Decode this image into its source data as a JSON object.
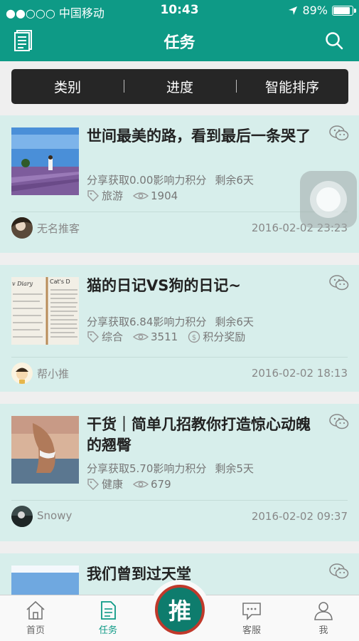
{
  "status_bar": {
    "carrier": "●●○○○ 中国移动",
    "time": "10:43",
    "battery": "89%",
    "battery_level": 0.89
  },
  "navbar": {
    "title": "任务",
    "left_icon": "document-list-icon",
    "right_icon": "search-icon"
  },
  "filters": [
    {
      "label": "类别"
    },
    {
      "label": "进度"
    },
    {
      "label": "智能排序"
    }
  ],
  "cards": [
    {
      "title": "世间最美的路，看到最后一条哭了",
      "reward": "分享获取0.00影响力积分",
      "remaining": "剩余6天",
      "category": "旅游",
      "views": "1904",
      "bonus": "",
      "author": "无名推客",
      "date": "2016-02-02 23:23"
    },
    {
      "title": "猫的日记VS狗的日记~",
      "reward": "分享获取6.84影响力积分",
      "remaining": "剩余6天",
      "category": "综合",
      "views": "3511",
      "bonus": "积分奖励",
      "author": "帮小推",
      "date": "2016-02-02 18:13"
    },
    {
      "title": "干货｜简单几招教你打造惊心动魄的翘臀",
      "reward": "分享获取5.70影响力积分",
      "remaining": "剩余5天",
      "category": "健康",
      "views": "679",
      "bonus": "",
      "author": "Snowy",
      "date": "2016-02-02 09:37"
    },
    {
      "title": "我们曾到过天堂"
    }
  ],
  "tabbar": {
    "home": "首页",
    "tasks": "任务",
    "push": "推",
    "service": "客服",
    "me": "我"
  },
  "colors": {
    "primary": "#0e9a86",
    "card_bg": "#d7eeeb",
    "push_ring": "#c0392b"
  }
}
